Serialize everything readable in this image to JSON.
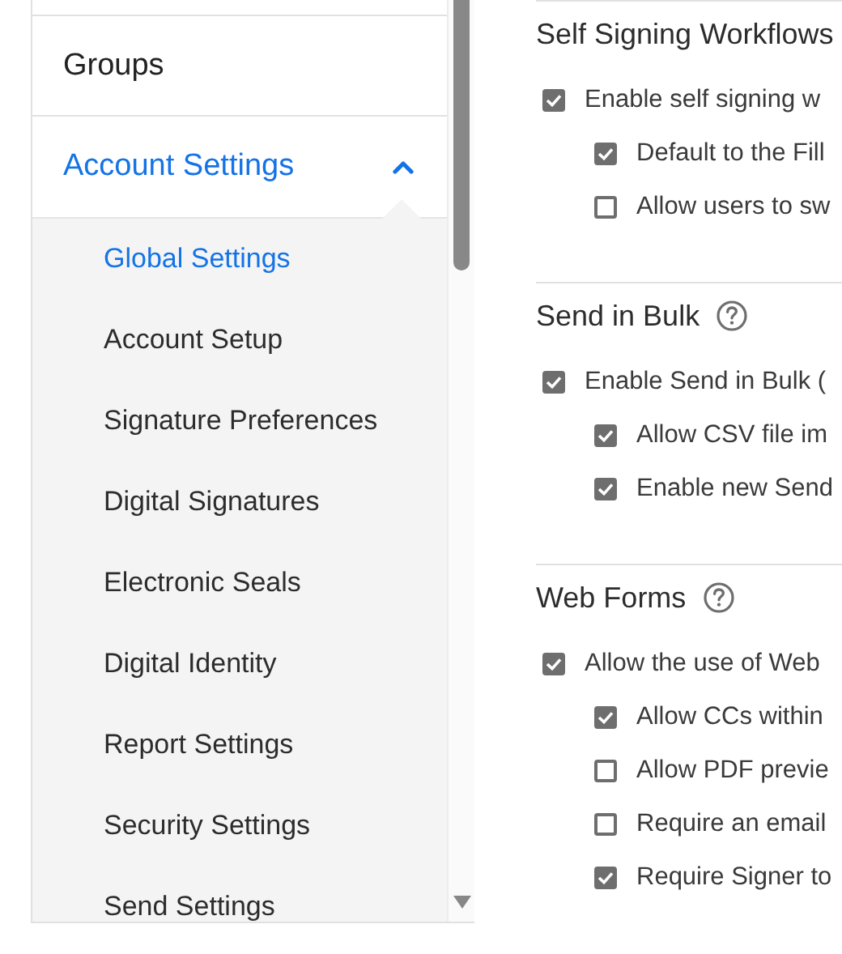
{
  "sidebar": {
    "items": [
      {
        "label": "Groups",
        "selected": false
      },
      {
        "label": "Account Settings",
        "selected": true,
        "expanded": true,
        "children": [
          {
            "label": "Global Settings",
            "selected": true
          },
          {
            "label": "Account Setup",
            "selected": false
          },
          {
            "label": "Signature Preferences",
            "selected": false
          },
          {
            "label": "Digital Signatures",
            "selected": false
          },
          {
            "label": "Electronic Seals",
            "selected": false
          },
          {
            "label": "Digital Identity",
            "selected": false
          },
          {
            "label": "Report Settings",
            "selected": false
          },
          {
            "label": "Security Settings",
            "selected": false
          },
          {
            "label": "Send Settings",
            "selected": false
          }
        ]
      }
    ]
  },
  "sections": [
    {
      "title": "Self Signing Workflows",
      "help": false,
      "options": [
        {
          "label": "Enable self signing w",
          "checked": true,
          "children": [
            {
              "label": "Default to the Fill",
              "checked": true
            },
            {
              "label": "Allow users to sw",
              "checked": false
            }
          ]
        }
      ]
    },
    {
      "title": "Send in Bulk",
      "help": true,
      "options": [
        {
          "label": "Enable Send in Bulk (",
          "checked": true,
          "children": [
            {
              "label": "Allow CSV file im",
              "checked": true
            },
            {
              "label": "Enable new Send",
              "checked": true
            }
          ]
        }
      ]
    },
    {
      "title": "Web Forms",
      "help": true,
      "options": [
        {
          "label": "Allow the use of Web",
          "checked": true,
          "children": [
            {
              "label": "Allow CCs within",
              "checked": true
            },
            {
              "label": "Allow PDF previe",
              "checked": false
            },
            {
              "label": "Require an email",
              "checked": false
            },
            {
              "label": "Require Signer to",
              "checked": true
            }
          ]
        }
      ]
    }
  ]
}
